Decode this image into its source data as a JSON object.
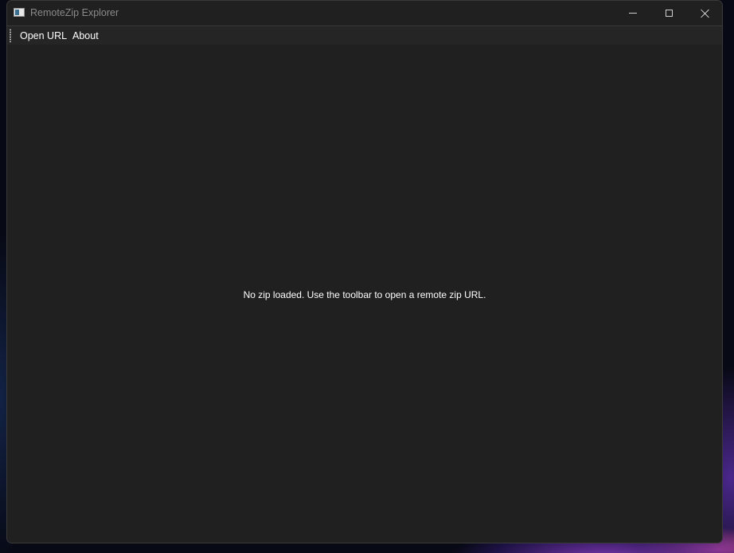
{
  "window": {
    "title": "RemoteZip Explorer",
    "icons": {
      "app": "app-window-icon",
      "minimize": "minimize-icon",
      "maximize": "maximize-icon",
      "close": "close-icon"
    }
  },
  "toolbar": {
    "items": [
      {
        "label": "Open URL"
      },
      {
        "label": "About"
      }
    ]
  },
  "content": {
    "empty_message": "No zip loaded. Use the toolbar to open a remote zip URL."
  },
  "colors": {
    "window_bg": "#202020",
    "toolbar_bg": "#252525",
    "text": "#ffffff",
    "title_text": "#8a8a8a"
  }
}
